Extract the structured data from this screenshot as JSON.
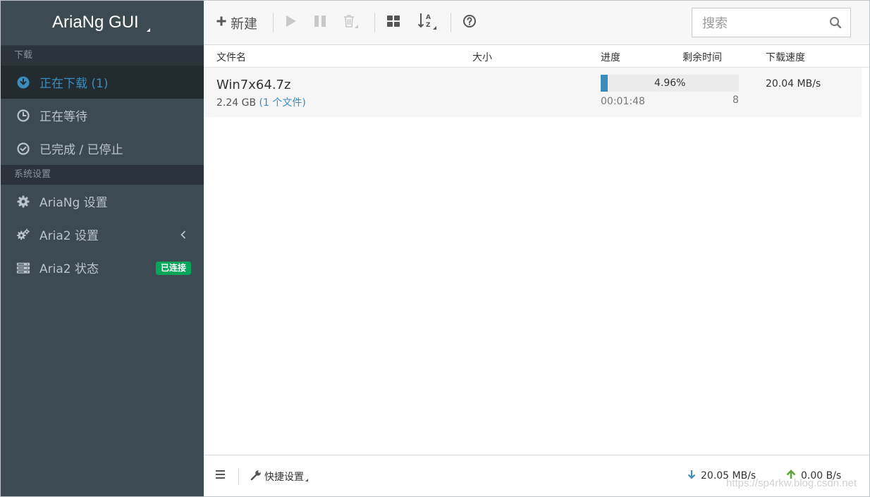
{
  "app": {
    "title": "AriaNg GUI"
  },
  "sidebar": {
    "sections": [
      {
        "label": "下载"
      },
      {
        "label": "系统设置"
      }
    ],
    "downloads": [
      {
        "label": "正在下载 (1)",
        "icon": "download-circle-icon",
        "active": true
      },
      {
        "label": "正在等待",
        "icon": "clock-icon"
      },
      {
        "label": "已完成 / 已停止",
        "icon": "check-circle-icon"
      }
    ],
    "settings": [
      {
        "label": "AriaNg 设置",
        "icon": "gear-icon"
      },
      {
        "label": "Aria2 设置",
        "icon": "gears-icon"
      },
      {
        "label": "Aria2 状态",
        "icon": "server-icon",
        "badge": "已连接"
      }
    ]
  },
  "toolbar": {
    "new_label": "新建",
    "search": {
      "placeholder": "搜索",
      "value": ""
    }
  },
  "table": {
    "headers": {
      "name": "文件名",
      "size": "大小",
      "progress": "进度",
      "remaining": "剩余时间",
      "speed": "下载速度"
    }
  },
  "task": {
    "name": "Win7x64.7z",
    "size": "2.24 GB",
    "files": "(1 个文件)",
    "progress_text": "4.96%",
    "progress": 0.0496,
    "remaining": "00:01:48",
    "connections": "8",
    "speed": "20.04 MB/s"
  },
  "footer": {
    "quick_settings": "快捷设置",
    "download_speed": "20.05 MB/s",
    "upload_speed": "0.00 B/s"
  },
  "watermark": "https://sp4rkw.blog.csdn.net",
  "colors": {
    "sidebar_bg": "#3c4a52",
    "accent": "#3c8dbc",
    "badge_green": "#00a65a",
    "upload_green": "#5ea73a"
  }
}
